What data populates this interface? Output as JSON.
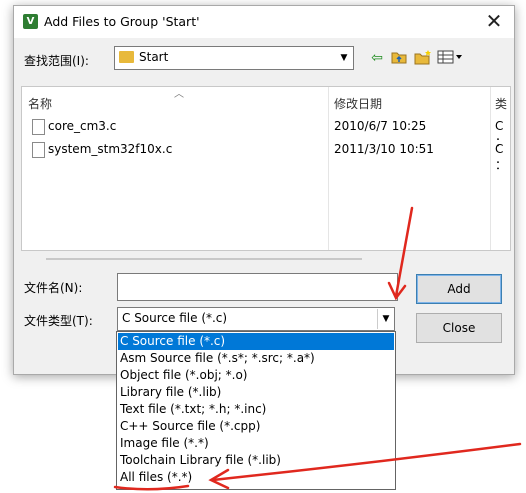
{
  "window": {
    "title": "Add Files to Group 'Start'",
    "icon": "app-icon-v",
    "close_glyph": "✕"
  },
  "lookin": {
    "label": "查找范围(I):",
    "value": "Start"
  },
  "toolbar": {
    "icons": [
      "back-icon",
      "up-folder-icon",
      "new-folder-icon",
      "view-menu-icon"
    ]
  },
  "filelist": {
    "columns": [
      "名称",
      "修改日期",
      "类"
    ],
    "rows": [
      {
        "name": "core_cm3.c",
        "modified": "2010/6/7 10:25",
        "type": "C ："
      },
      {
        "name": "system_stm32f10x.c",
        "modified": "2011/3/10 10:51",
        "type": "C ："
      }
    ]
  },
  "filename": {
    "label": "文件名(N):",
    "value": ""
  },
  "filetype": {
    "label": "文件类型(T):",
    "value": "C Source file (*.c)",
    "options": [
      "C Source file (*.c)",
      "Asm Source file (*.s*; *.src; *.a*)",
      "Object file (*.obj; *.o)",
      "Library file (*.lib)",
      "Text file (*.txt; *.h; *.inc)",
      "C++ Source file (*.cpp)",
      "Image file (*.*)",
      "Toolchain Library file (*.lib)",
      "All files (*.*)"
    ],
    "selected_index": 0
  },
  "buttons": {
    "add": "Add",
    "close": "Close"
  },
  "annotations": {
    "color": "#e0281e"
  }
}
